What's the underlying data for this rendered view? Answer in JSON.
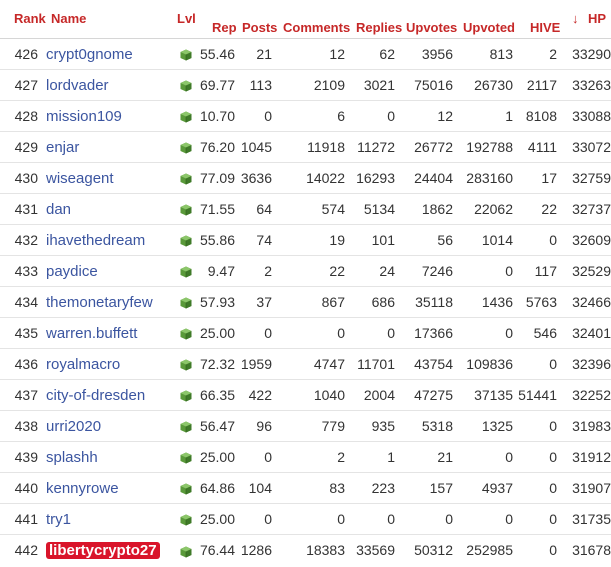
{
  "headers": {
    "rank": "Rank",
    "name": "Name",
    "lvl": "Lvl",
    "rep": "Rep",
    "posts": "Posts",
    "comments": "Comments",
    "replies": "Replies",
    "upvotes": "Upvotes",
    "upvoted": "Upvoted",
    "hive": "HIVE",
    "hp_arrow": "↓",
    "hp": "HP"
  },
  "colors": {
    "header": "#c62828",
    "link": "#3b55a0",
    "highlight": "#d9142a",
    "cube": "#5a9a3a"
  },
  "icon": "green-cube-icon",
  "rows": [
    {
      "rank": "426",
      "name": "crypt0gnome",
      "rep": "55.46",
      "posts": "21",
      "comments": "12",
      "replies": "62",
      "upvotes": "3956",
      "upvoted": "813",
      "hive": "2",
      "hp": "33290"
    },
    {
      "rank": "427",
      "name": "lordvader",
      "rep": "69.77",
      "posts": "113",
      "comments": "2109",
      "replies": "3021",
      "upvotes": "75016",
      "upvoted": "26730",
      "hive": "2117",
      "hp": "33263"
    },
    {
      "rank": "428",
      "name": "mission109",
      "rep": "10.70",
      "posts": "0",
      "comments": "6",
      "replies": "0",
      "upvotes": "12",
      "upvoted": "1",
      "hive": "8108",
      "hp": "33088"
    },
    {
      "rank": "429",
      "name": "enjar",
      "rep": "76.20",
      "posts": "1045",
      "comments": "11918",
      "replies": "11272",
      "upvotes": "26772",
      "upvoted": "192788",
      "hive": "4111",
      "hp": "33072"
    },
    {
      "rank": "430",
      "name": "wiseagent",
      "rep": "77.09",
      "posts": "3636",
      "comments": "14022",
      "replies": "16293",
      "upvotes": "24404",
      "upvoted": "283160",
      "hive": "17",
      "hp": "32759"
    },
    {
      "rank": "431",
      "name": "dan",
      "rep": "71.55",
      "posts": "64",
      "comments": "574",
      "replies": "5134",
      "upvotes": "1862",
      "upvoted": "22062",
      "hive": "22",
      "hp": "32737"
    },
    {
      "rank": "432",
      "name": "ihavethedream",
      "rep": "55.86",
      "posts": "74",
      "comments": "19",
      "replies": "101",
      "upvotes": "56",
      "upvoted": "1014",
      "hive": "0",
      "hp": "32609"
    },
    {
      "rank": "433",
      "name": "paydice",
      "rep": "9.47",
      "posts": "2",
      "comments": "22",
      "replies": "24",
      "upvotes": "7246",
      "upvoted": "0",
      "hive": "117",
      "hp": "32529"
    },
    {
      "rank": "434",
      "name": "themonetaryfew",
      "rep": "57.93",
      "posts": "37",
      "comments": "867",
      "replies": "686",
      "upvotes": "35118",
      "upvoted": "1436",
      "hive": "5763",
      "hp": "32466"
    },
    {
      "rank": "435",
      "name": "warren.buffett",
      "rep": "25.00",
      "posts": "0",
      "comments": "0",
      "replies": "0",
      "upvotes": "17366",
      "upvoted": "0",
      "hive": "546",
      "hp": "32401"
    },
    {
      "rank": "436",
      "name": "royalmacro",
      "rep": "72.32",
      "posts": "1959",
      "comments": "4747",
      "replies": "11701",
      "upvotes": "43754",
      "upvoted": "109836",
      "hive": "0",
      "hp": "32396"
    },
    {
      "rank": "437",
      "name": "city-of-dresden",
      "rep": "66.35",
      "posts": "422",
      "comments": "1040",
      "replies": "2004",
      "upvotes": "47275",
      "upvoted": "37135",
      "hive": "51441",
      "hp": "32252"
    },
    {
      "rank": "438",
      "name": "urri2020",
      "rep": "56.47",
      "posts": "96",
      "comments": "779",
      "replies": "935",
      "upvotes": "5318",
      "upvoted": "1325",
      "hive": "0",
      "hp": "31983"
    },
    {
      "rank": "439",
      "name": "splashh",
      "rep": "25.00",
      "posts": "0",
      "comments": "2",
      "replies": "1",
      "upvotes": "21",
      "upvoted": "0",
      "hive": "0",
      "hp": "31912"
    },
    {
      "rank": "440",
      "name": "kennyrowe",
      "rep": "64.86",
      "posts": "104",
      "comments": "83",
      "replies": "223",
      "upvotes": "157",
      "upvoted": "4937",
      "hive": "0",
      "hp": "31907"
    },
    {
      "rank": "441",
      "name": "try1",
      "rep": "25.00",
      "posts": "0",
      "comments": "0",
      "replies": "0",
      "upvotes": "0",
      "upvoted": "0",
      "hive": "0",
      "hp": "31735"
    },
    {
      "rank": "442",
      "name": "libertycrypto27",
      "rep": "76.44",
      "posts": "1286",
      "comments": "18383",
      "replies": "33569",
      "upvotes": "50312",
      "upvoted": "252985",
      "hive": "0",
      "hp": "31678",
      "highlighted": true
    }
  ]
}
